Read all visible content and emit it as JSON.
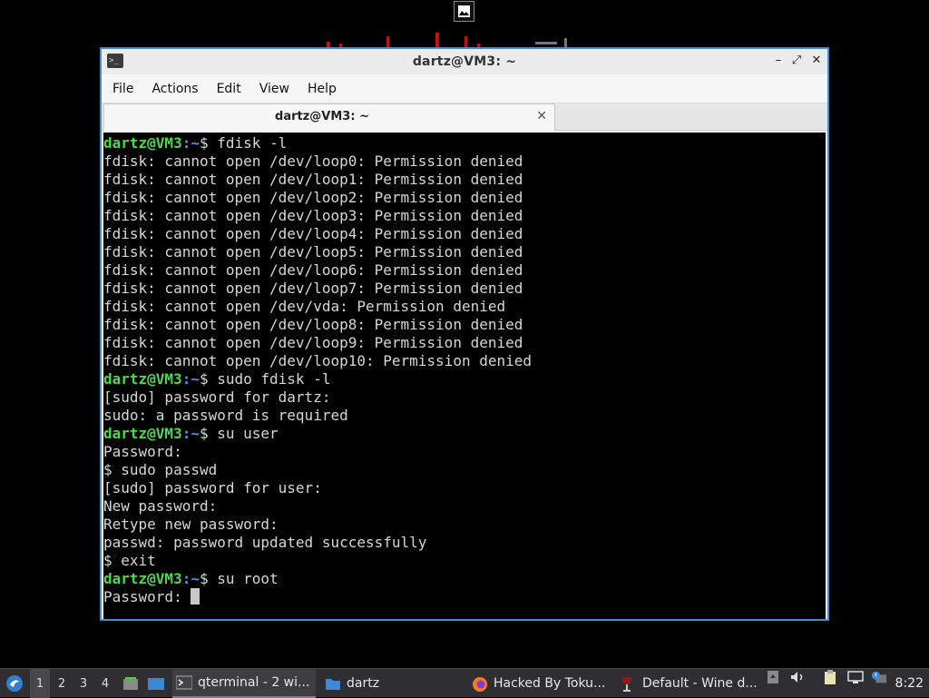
{
  "window": {
    "title": "dartz@VM3: ~",
    "controls": {
      "minimize": "–",
      "maximize": "⤢",
      "close": "✕"
    }
  },
  "menu": [
    "File",
    "Actions",
    "Edit",
    "View",
    "Help"
  ],
  "tab": {
    "label": "dartz@VM3: ~",
    "close": "✕"
  },
  "prompt": {
    "user": "dartz@VM3",
    "path": ":~",
    "symbol": "$ "
  },
  "terminal_lines": [
    {
      "type": "prompt",
      "text": "fdisk -l"
    },
    {
      "type": "out",
      "text": "fdisk: cannot open /dev/loop0: Permission denied"
    },
    {
      "type": "out",
      "text": "fdisk: cannot open /dev/loop1: Permission denied"
    },
    {
      "type": "out",
      "text": "fdisk: cannot open /dev/loop2: Permission denied"
    },
    {
      "type": "out",
      "text": "fdisk: cannot open /dev/loop3: Permission denied"
    },
    {
      "type": "out",
      "text": "fdisk: cannot open /dev/loop4: Permission denied"
    },
    {
      "type": "out",
      "text": "fdisk: cannot open /dev/loop5: Permission denied"
    },
    {
      "type": "out",
      "text": "fdisk: cannot open /dev/loop6: Permission denied"
    },
    {
      "type": "out",
      "text": "fdisk: cannot open /dev/loop7: Permission denied"
    },
    {
      "type": "out",
      "text": "fdisk: cannot open /dev/vda: Permission denied"
    },
    {
      "type": "out",
      "text": "fdisk: cannot open /dev/loop8: Permission denied"
    },
    {
      "type": "out",
      "text": "fdisk: cannot open /dev/loop9: Permission denied"
    },
    {
      "type": "out",
      "text": "fdisk: cannot open /dev/loop10: Permission denied"
    },
    {
      "type": "prompt",
      "text": "sudo fdisk -l"
    },
    {
      "type": "out",
      "text": "[sudo] password for dartz:"
    },
    {
      "type": "out",
      "text": "sudo: a password is required"
    },
    {
      "type": "prompt",
      "text": "su user"
    },
    {
      "type": "out",
      "text": "Password:"
    },
    {
      "type": "out",
      "text": "$ sudo passwd"
    },
    {
      "type": "out",
      "text": "[sudo] password for user:"
    },
    {
      "type": "out",
      "text": "New password:"
    },
    {
      "type": "out",
      "text": "Retype new password:"
    },
    {
      "type": "out",
      "text": "passwd: password updated successfully"
    },
    {
      "type": "out",
      "text": "$ exit"
    },
    {
      "type": "prompt",
      "text": "su root"
    },
    {
      "type": "cursor",
      "text": "Password: "
    }
  ],
  "taskbar": {
    "workspaces": [
      "1",
      "2",
      "3",
      "4"
    ],
    "active_workspace": "1",
    "tasks": [
      {
        "label": "qterminal - 2 wi...",
        "icon": "terminal-icon",
        "active": true
      },
      {
        "label": "dartz",
        "icon": "folder-icon",
        "active": false
      },
      {
        "label": "Hacked By Toku...",
        "icon": "firefox-icon",
        "active": false
      },
      {
        "label": "Default - Wine d...",
        "icon": "wine-icon",
        "active": false
      }
    ],
    "clock": "8:22"
  },
  "colors": {
    "accent": "#3f8fd2",
    "prompt_user": "#4fd84f",
    "prompt_path": "#5b8fe0",
    "terminal_bg": "#000000",
    "terminal_fg": "#d6d6d6",
    "taskbar_bg": "#2f2f33"
  }
}
